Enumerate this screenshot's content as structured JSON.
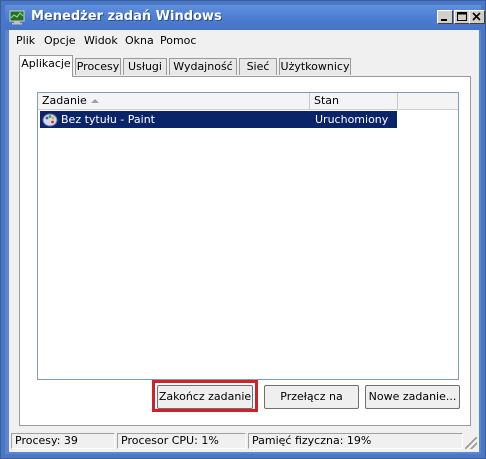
{
  "window": {
    "title": "Menedżer zadań Windows"
  },
  "menu": {
    "items": [
      "Plik",
      "Opcje",
      "Widok",
      "Okna",
      "Pomoc"
    ]
  },
  "tabs": [
    {
      "label": "Aplikacje",
      "active": true
    },
    {
      "label": "Procesy",
      "active": false
    },
    {
      "label": "Usługi",
      "active": false
    },
    {
      "label": "Wydajność",
      "active": false
    },
    {
      "label": "Sieć",
      "active": false
    },
    {
      "label": "Użytkownicy",
      "active": false
    }
  ],
  "list": {
    "columns": [
      "Zadanie",
      "Stan"
    ],
    "rows": [
      {
        "task": "Bez tytułu - Paint",
        "status": "Uruchomiony",
        "icon": "paint-icon",
        "selected": true
      }
    ]
  },
  "buttons": {
    "end_task": "Zakończ zadanie",
    "switch_to": "Przełącz na",
    "new_task": "Nowe zadanie..."
  },
  "status": {
    "processes": "Procesy: 39",
    "cpu": "Procesor CPU: 1%",
    "memory": "Pamięć fizyczna: 19%"
  },
  "colors": {
    "title_bar": "#4a7bd0",
    "selection": "#0a246a",
    "highlight_box": "#d0202a"
  }
}
